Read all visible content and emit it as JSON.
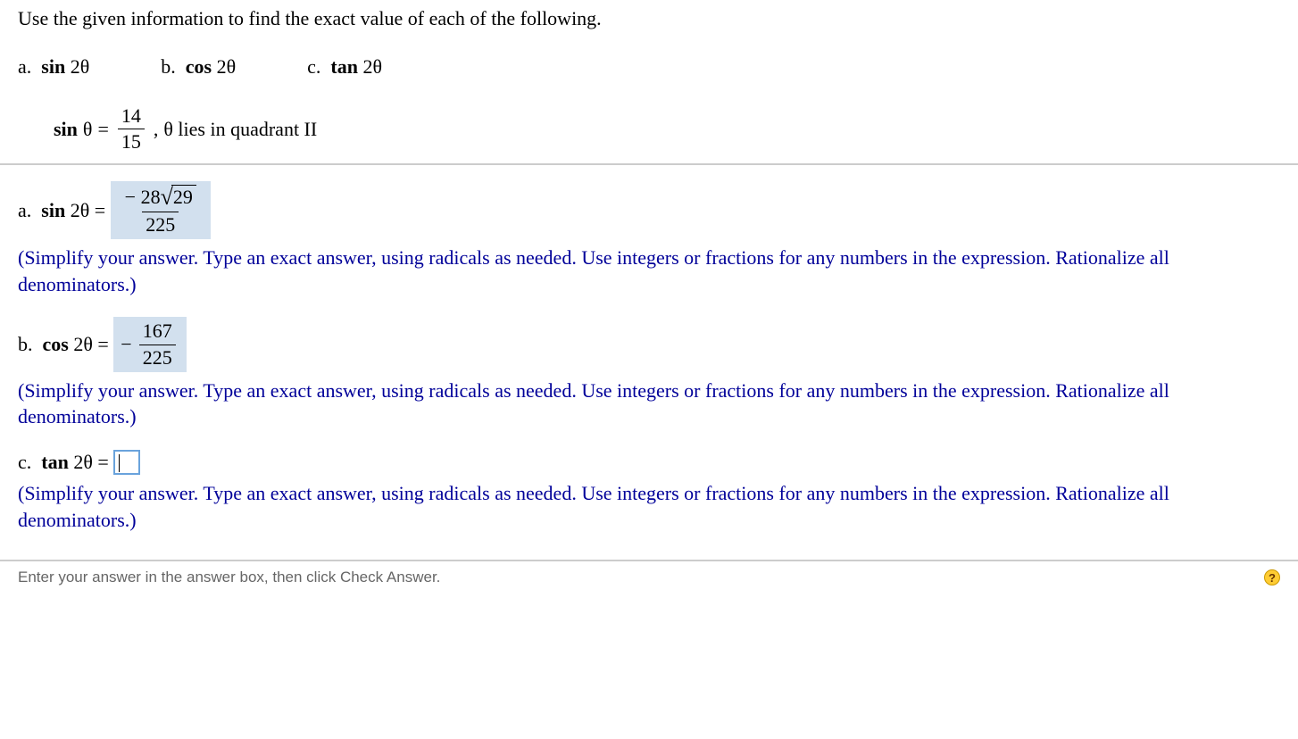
{
  "prompt": "Use the given information to find the exact value of each of the following.",
  "options": {
    "a_label": "a.",
    "a_expr_fn": "sin",
    "a_expr_arg": "2θ",
    "b_label": "b.",
    "b_expr_fn": "cos",
    "b_expr_arg": "2θ",
    "c_label": "c.",
    "c_expr_fn": "tan",
    "c_expr_arg": "2θ"
  },
  "given": {
    "fn": "sin",
    "var": "θ",
    "eq": "=",
    "num": "14",
    "den": "15",
    "comma": ",",
    "note": "θ lies in quadrant II"
  },
  "answers": {
    "a": {
      "label": "a.",
      "fn": "sin",
      "arg": "2θ",
      "eq": "=",
      "num_pre": "− 28",
      "num_sqrt": "29",
      "den": "225"
    },
    "b": {
      "label": "b.",
      "fn": "cos",
      "arg": "2θ",
      "eq": "=",
      "sign": "−",
      "num": "167",
      "den": "225"
    },
    "c": {
      "label": "c.",
      "fn": "tan",
      "arg": "2θ",
      "eq": "="
    }
  },
  "hint": "(Simplify your answer. Type an exact answer, using radicals as needed. Use integers or fractions for any numbers in the expression. Rationalize all denominators.)",
  "bottom": "Enter your answer in the answer box, then click Check Answer.",
  "help": "?"
}
